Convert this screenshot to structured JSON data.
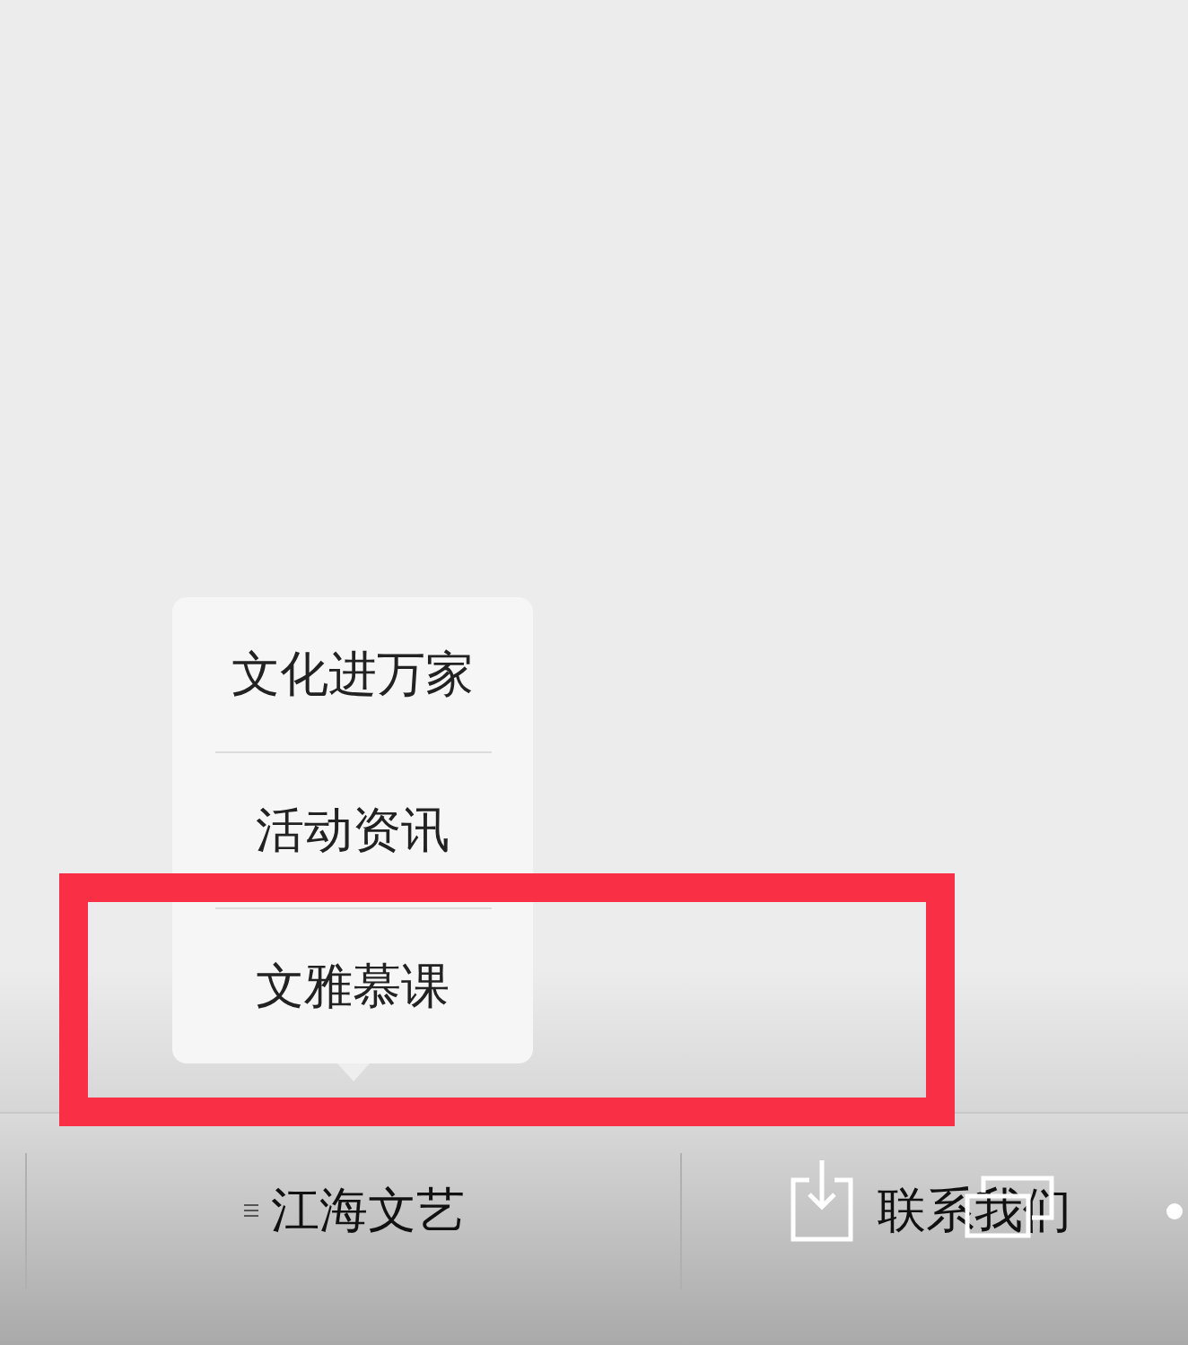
{
  "popup_menu": {
    "items": [
      {
        "label": "文化进万家"
      },
      {
        "label": "活动资讯"
      },
      {
        "label": "文雅慕课"
      }
    ]
  },
  "bottom_bar": {
    "items": [
      {
        "label": "江海文艺",
        "kind": "menu"
      },
      {
        "label": "联系我们",
        "kind": "plain"
      }
    ]
  }
}
